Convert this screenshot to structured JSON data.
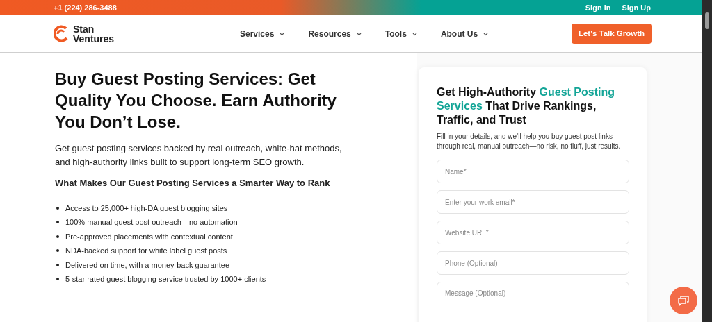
{
  "topbar": {
    "phone": "+1 (224) 286-3488",
    "links": [
      "Sign In",
      "Sign Up"
    ]
  },
  "header": {
    "logo": [
      "Stan",
      "Ventures"
    ],
    "nav": [
      "Services",
      "Resources",
      "Tools",
      "About Us"
    ],
    "cta": "Let's Talk Growth"
  },
  "hero": {
    "title": "Buy Guest Posting Services: Get Quality You Choose. Earn Authority You Don’t Lose.",
    "lead": "Get guest posting services backed by real outreach, white-hat methods, and high-authority links built to support long-term SEO growth.",
    "subtitle": "What Makes Our Guest Posting Services a Smarter Way to Rank",
    "bullets": [
      "Access to 25,000+ high-DA guest blogging sites",
      "100% manual guest post outreach—no automation",
      "Pre-approved placements with contextual content",
      "NDA-backed support for white label guest posts",
      "Delivered on time, with a money-back guarantee",
      "5-star rated guest blogging service trusted by 1000+ clients"
    ]
  },
  "form": {
    "title": [
      {
        "text": "Get High-Authority ",
        "highlight": false
      },
      {
        "text": "Guest Posting Services",
        "highlight": true
      },
      {
        "text": " That Drive Rankings, Traffic, and Trust",
        "highlight": false
      }
    ],
    "intro": "Fill in your details, and we’ll help you buy guest post links through real, manual outreach—no risk, no fluff, just results.",
    "fields": [
      {
        "placeholder": "Name*",
        "kind": "input"
      },
      {
        "placeholder": "Enter your work email*",
        "kind": "input"
      },
      {
        "placeholder": "Website URL*",
        "kind": "input"
      },
      {
        "placeholder": "Phone (Optional)",
        "kind": "input"
      },
      {
        "placeholder": "Message (Optional)",
        "kind": "textarea"
      }
    ]
  }
}
